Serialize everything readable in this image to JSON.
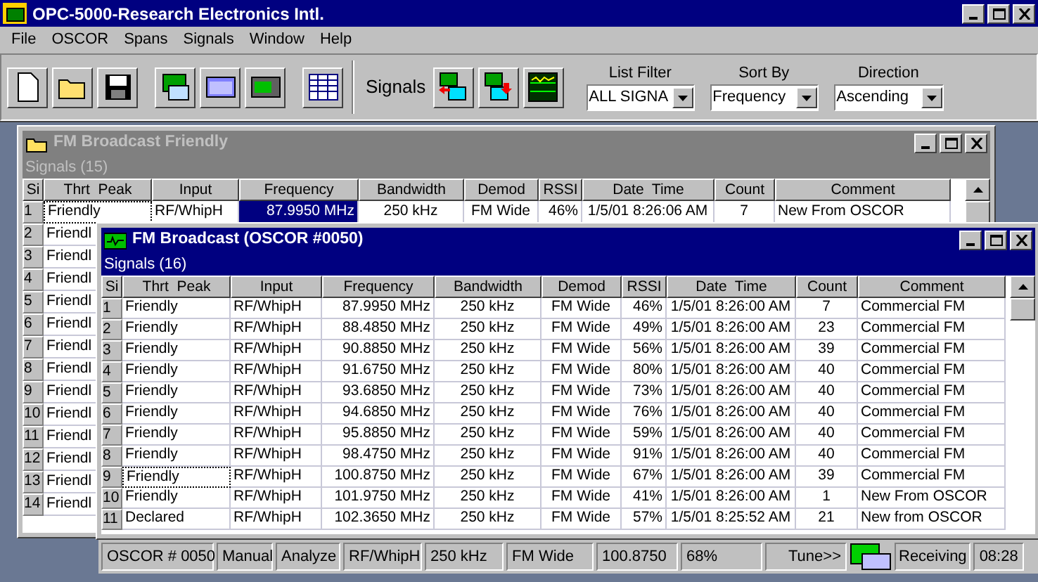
{
  "window": {
    "title": "OPC-5000-Research Electronics Intl."
  },
  "menu": [
    "File",
    "OSCOR",
    "Spans",
    "Signals",
    "Window",
    "Help"
  ],
  "toolbar": {
    "signals_label": "Signals",
    "filters": [
      {
        "label": "List Filter",
        "value": "ALL SIGNA"
      },
      {
        "label": "Sort By",
        "value": "Frequency"
      },
      {
        "label": "Direction",
        "value": "Ascending"
      }
    ]
  },
  "back_window": {
    "title": "FM Broadcast Friendly",
    "active": false,
    "list_title": "Signals (15)",
    "columns": [
      "Si",
      "Thrt  Peak",
      "Input",
      "Frequency",
      "Bandwidth",
      "Demod",
      "RSSI",
      "Date  Time",
      "Count",
      "Comment"
    ],
    "rows": [
      {
        "cells": [
          "1",
          "Friendly",
          "RF/WhipH",
          "87.9950 MHz",
          "250 kHz",
          "FM Wide",
          "46%",
          "1/5/01 8:26:06 AM",
          "7",
          "New From OSCOR"
        ],
        "selected": true,
        "focused": true
      },
      {
        "cells": [
          "2",
          "Friendl"
        ],
        "selected": false,
        "focused": false
      },
      {
        "cells": [
          "3",
          "Friendl"
        ],
        "selected": false,
        "focused": false
      },
      {
        "cells": [
          "4",
          "Friendl"
        ],
        "selected": false,
        "focused": false
      },
      {
        "cells": [
          "5",
          "Friendl"
        ],
        "selected": false,
        "focused": false
      },
      {
        "cells": [
          "6",
          "Friendl"
        ],
        "selected": false,
        "focused": false
      },
      {
        "cells": [
          "7",
          "Friendl"
        ],
        "selected": false,
        "focused": false
      },
      {
        "cells": [
          "8",
          "Friendl"
        ],
        "selected": false,
        "focused": false
      },
      {
        "cells": [
          "9",
          "Friendl"
        ],
        "selected": false,
        "focused": false
      },
      {
        "cells": [
          "10",
          "Friendl"
        ],
        "selected": false,
        "focused": false
      },
      {
        "cells": [
          "11",
          "Friendl"
        ],
        "selected": false,
        "focused": false
      },
      {
        "cells": [
          "12",
          "Friendl"
        ],
        "selected": false,
        "focused": false
      },
      {
        "cells": [
          "13",
          "Friendl"
        ],
        "selected": false,
        "focused": false
      },
      {
        "cells": [
          "14",
          "Friendl"
        ],
        "selected": false,
        "focused": false
      }
    ]
  },
  "front_window": {
    "title": "FM Broadcast (OSCOR #0050)",
    "active": true,
    "list_title": "Signals (16)",
    "columns": [
      "Si",
      "Thrt  Peak",
      "Input",
      "Frequency",
      "Bandwidth",
      "Demod",
      "RSSI",
      "Date  Time",
      "Count",
      "Comment"
    ],
    "rows": [
      {
        "cells": [
          "1",
          "Friendly",
          "RF/WhipH",
          "87.9950 MHz",
          "250 kHz",
          "FM Wide",
          "46%",
          "1/5/01 8:26:00 AM",
          "7",
          "Commercial FM"
        ],
        "selected": false,
        "focused": false
      },
      {
        "cells": [
          "2",
          "Friendly",
          "RF/WhipH",
          "88.4850 MHz",
          "250 kHz",
          "FM Wide",
          "49%",
          "1/5/01 8:26:00 AM",
          "23",
          "Commercial FM"
        ],
        "selected": false,
        "focused": false
      },
      {
        "cells": [
          "3",
          "Friendly",
          "RF/WhipH",
          "90.8850 MHz",
          "250 kHz",
          "FM Wide",
          "56%",
          "1/5/01 8:26:00 AM",
          "39",
          "Commercial FM"
        ],
        "selected": false,
        "focused": false
      },
      {
        "cells": [
          "4",
          "Friendly",
          "RF/WhipH",
          "91.6750 MHz",
          "250 kHz",
          "FM Wide",
          "80%",
          "1/5/01 8:26:00 AM",
          "40",
          "Commercial FM"
        ],
        "selected": false,
        "focused": false
      },
      {
        "cells": [
          "5",
          "Friendly",
          "RF/WhipH",
          "93.6850 MHz",
          "250 kHz",
          "FM Wide",
          "73%",
          "1/5/01 8:26:00 AM",
          "40",
          "Commercial FM"
        ],
        "selected": false,
        "focused": false
      },
      {
        "cells": [
          "6",
          "Friendly",
          "RF/WhipH",
          "94.6850 MHz",
          "250 kHz",
          "FM Wide",
          "76%",
          "1/5/01 8:26:00 AM",
          "40",
          "Commercial FM"
        ],
        "selected": false,
        "focused": false
      },
      {
        "cells": [
          "7",
          "Friendly",
          "RF/WhipH",
          "95.8850 MHz",
          "250 kHz",
          "FM Wide",
          "59%",
          "1/5/01 8:26:00 AM",
          "40",
          "Commercial FM"
        ],
        "selected": false,
        "focused": false
      },
      {
        "cells": [
          "8",
          "Friendly",
          "RF/WhipH",
          "98.4750 MHz",
          "250 kHz",
          "FM Wide",
          "91%",
          "1/5/01 8:26:00 AM",
          "40",
          "Commercial FM"
        ],
        "selected": false,
        "focused": false
      },
      {
        "cells": [
          "9",
          "Friendly",
          "RF/WhipH",
          "100.8750 MHz",
          "250 kHz",
          "FM Wide",
          "67%",
          "1/5/01 8:26:00 AM",
          "39",
          "Commercial FM"
        ],
        "selected": false,
        "focused": true
      },
      {
        "cells": [
          "10",
          "Friendly",
          "RF/WhipH",
          "101.9750 MHz",
          "250 kHz",
          "FM Wide",
          "41%",
          "1/5/01 8:26:00 AM",
          "1",
          "New From OSCOR"
        ],
        "selected": false,
        "focused": false
      },
      {
        "cells": [
          "11",
          "Declared",
          "RF/WhipH",
          "102.3650 MHz",
          "250 kHz",
          "FM Wide",
          "57%",
          "1/5/01 8:25:52 AM",
          "21",
          "New from OSCOR"
        ],
        "selected": false,
        "focused": false
      }
    ]
  },
  "status_bar": [
    "OSCOR # 0050",
    "Manual",
    "Analyze",
    "RF/WhipH",
    "250 kHz",
    "FM Wide",
    "100.8750",
    "68%",
    "Tune>>",
    "Receiving",
    "08:28"
  ]
}
